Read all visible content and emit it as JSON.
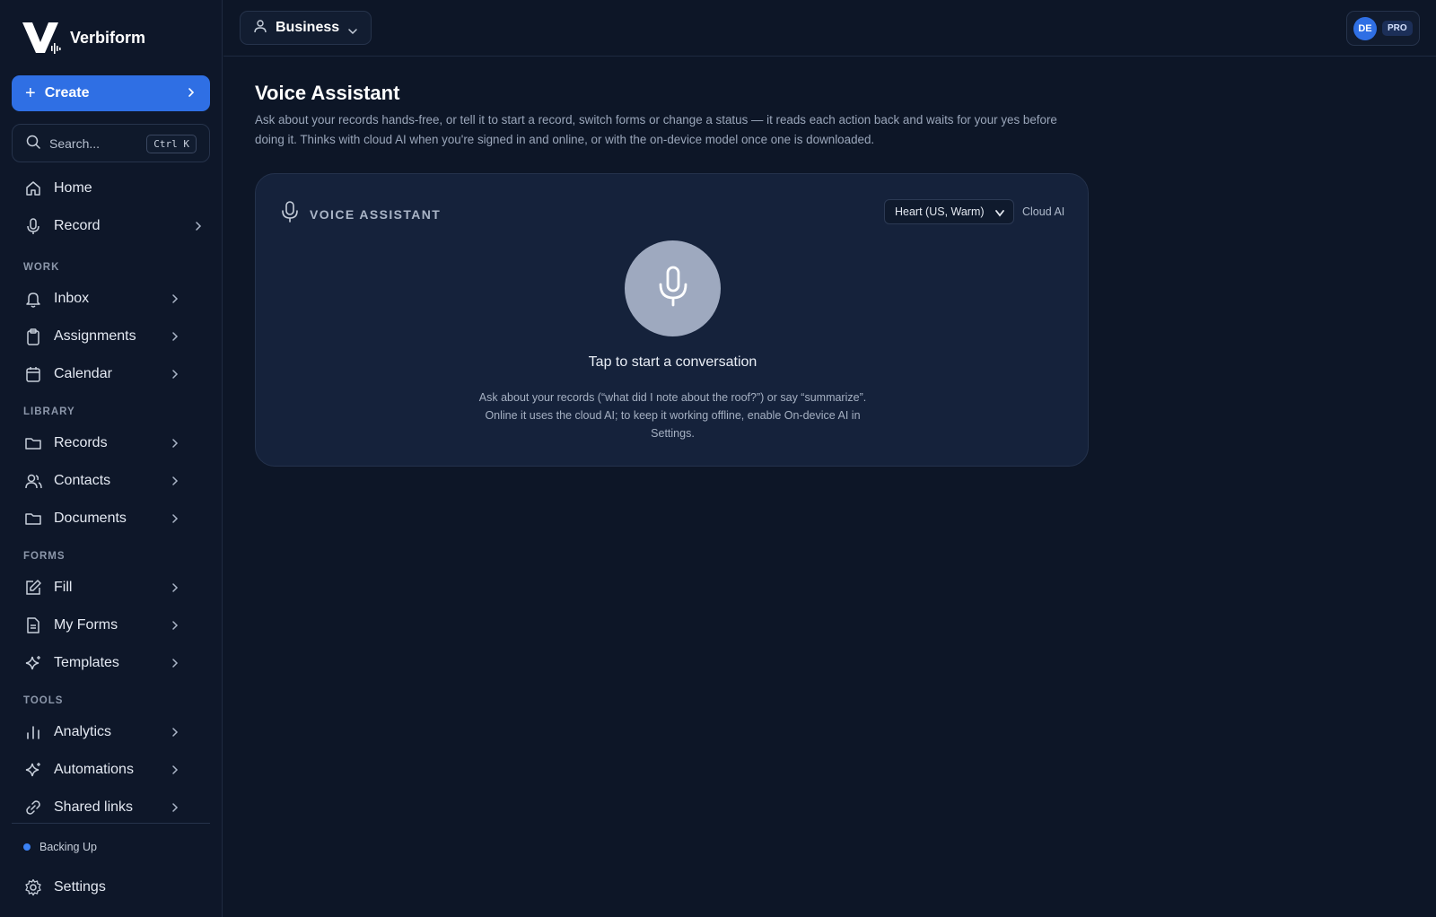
{
  "brand": {
    "name": "Verbiform"
  },
  "sidebar": {
    "create_label": "Create",
    "search": {
      "placeholder": "Search...",
      "shortcut": "Ctrl K"
    },
    "top_items": [
      {
        "label": "Home",
        "icon": "home-icon"
      },
      {
        "label": "Record",
        "icon": "mic-icon"
      }
    ],
    "sections": [
      {
        "label": "WORK",
        "items": [
          {
            "label": "Inbox",
            "icon": "bell-icon"
          },
          {
            "label": "Assignments",
            "icon": "clipboard-icon"
          },
          {
            "label": "Calendar",
            "icon": "calendar-icon"
          }
        ]
      },
      {
        "label": "LIBRARY",
        "items": [
          {
            "label": "Records",
            "icon": "folder-icon"
          },
          {
            "label": "Contacts",
            "icon": "users-icon"
          },
          {
            "label": "Documents",
            "icon": "folder-icon"
          }
        ]
      },
      {
        "label": "FORMS",
        "items": [
          {
            "label": "Fill",
            "icon": "edit-icon"
          },
          {
            "label": "My Forms",
            "icon": "file-text-icon"
          },
          {
            "label": "Templates",
            "icon": "sparkles-icon"
          }
        ]
      },
      {
        "label": "TOOLS",
        "items": [
          {
            "label": "Analytics",
            "icon": "bar-chart-icon"
          },
          {
            "label": "Automations",
            "icon": "sparkles-icon"
          },
          {
            "label": "Shared links",
            "icon": "link-icon"
          }
        ]
      }
    ],
    "status": "Backing Up",
    "settings_label": "Settings"
  },
  "topbar": {
    "workspace": "Business",
    "avatar_initials": "DE",
    "plan_badge": "PRO"
  },
  "main": {
    "title": "Voice Assistant",
    "description": "Ask about your records hands-free, or tell it to start a record, switch forms or change a status — it reads each action back and waits for your yes before doing it. Thinks with cloud AI when you're signed in and online, or with the on-device model once one is downloaded.",
    "card": {
      "title": "VOICE ASSISTANT",
      "voice_selected": "Heart (US, Warm)",
      "engine": "Cloud AI",
      "cta": "Tap to start a conversation",
      "hint": "Ask about your records (“what did I note about the roof?”) or say “summarize”. Online it uses the cloud AI; to keep it working offline, enable On-device AI in Settings."
    }
  },
  "colors": {
    "accent": "#2f6fe4",
    "background": "#0d1627",
    "card": "#15223b",
    "status_dot": "#3b82f6"
  }
}
